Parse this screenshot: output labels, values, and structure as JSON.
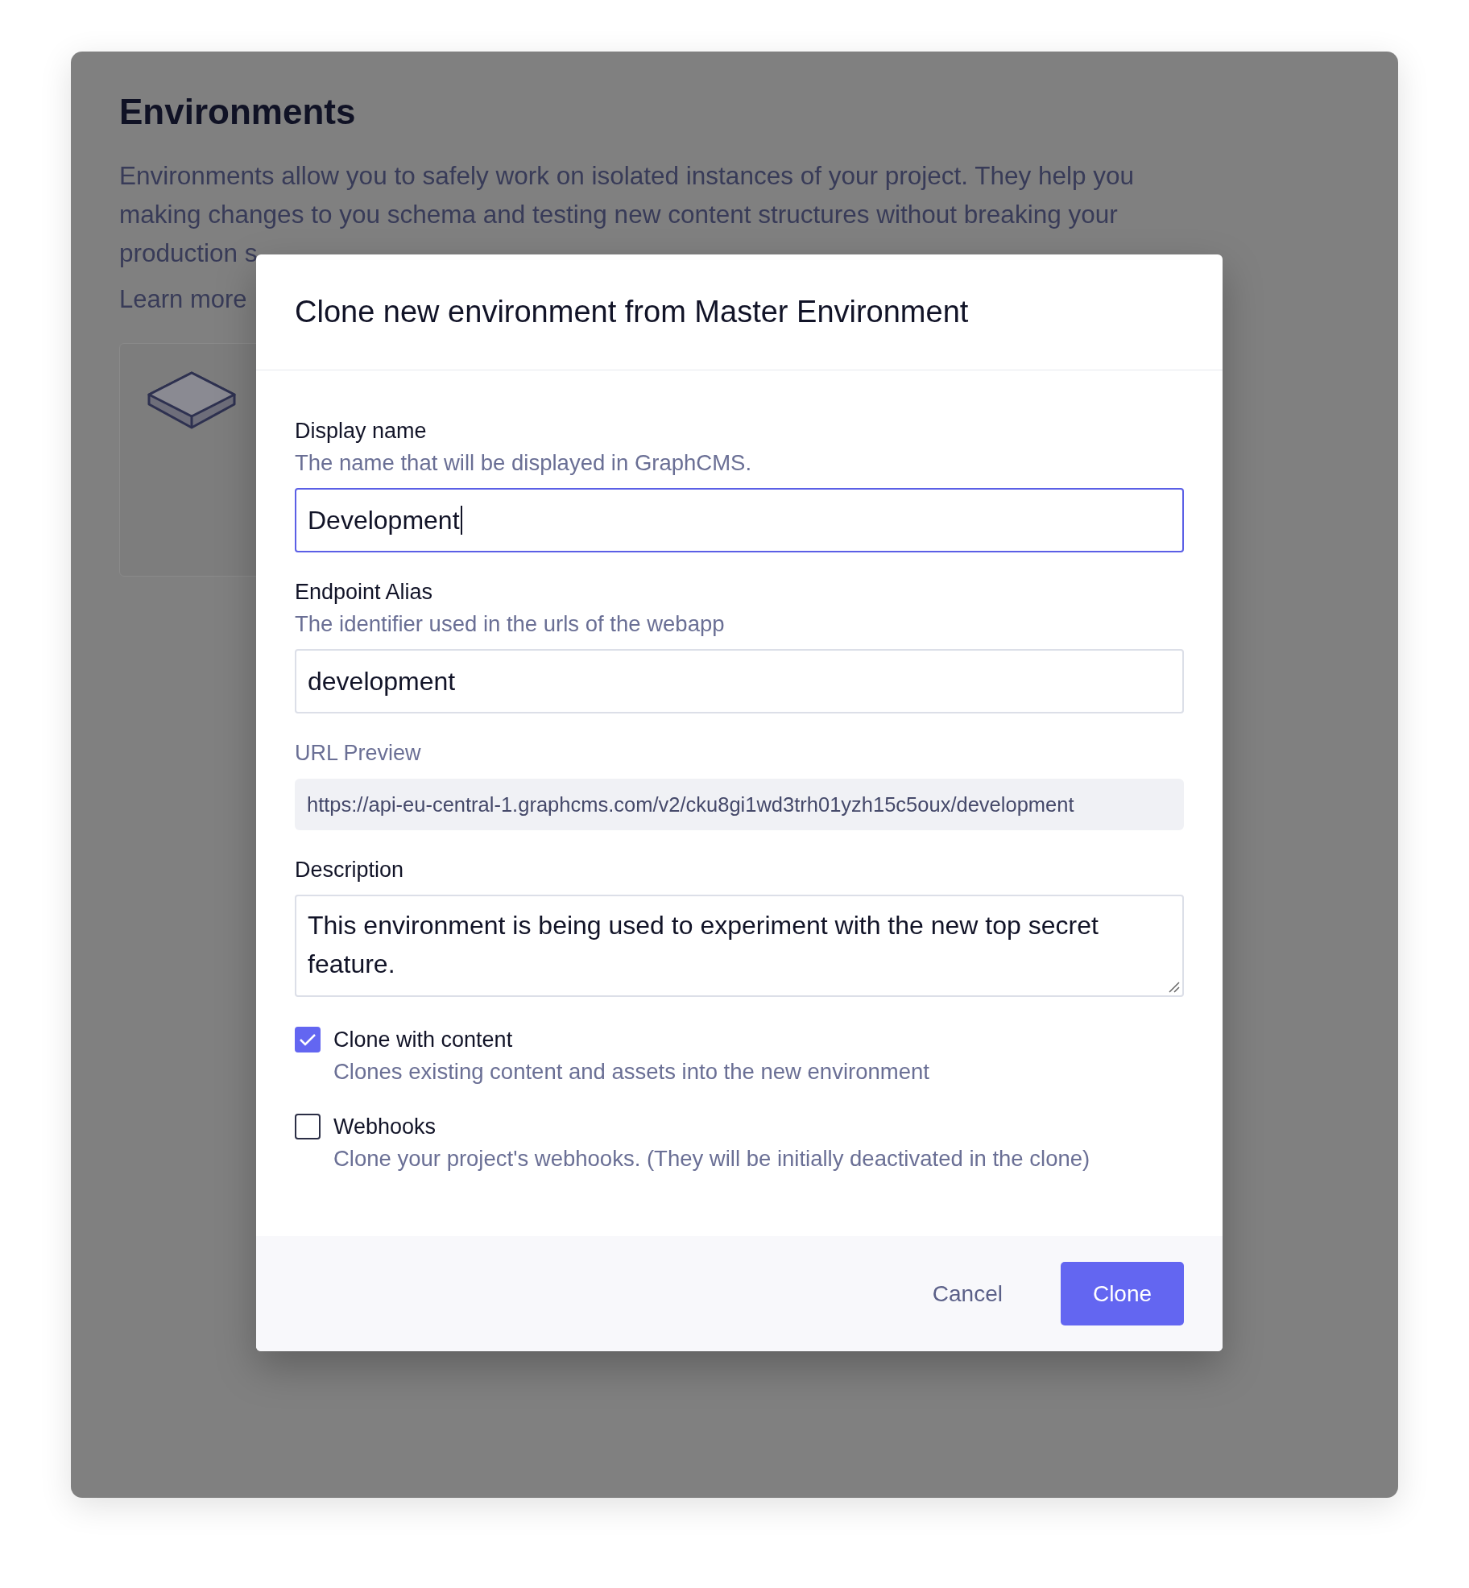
{
  "page": {
    "title": "Environments",
    "description_lines": [
      "Environments allow you to safely work on isolated instances of your project. They help you",
      "making changes to you schema and testing new content structures without breaking your",
      "production s"
    ],
    "link": "Learn more"
  },
  "dialog": {
    "title": "Clone new environment from Master Environment",
    "fields": [
      {
        "kind": "text",
        "label": "Display name",
        "hint": "The name that will be displayed in GraphCMS.",
        "value": "Development",
        "focused": true
      },
      {
        "kind": "text",
        "label": "Endpoint Alias",
        "hint": "The identifier used in the urls of the webapp",
        "value": "development",
        "focused": false
      },
      {
        "kind": "preview",
        "label": "URL Preview",
        "value": "https://api-eu-central-1.graphcms.com/v2/cku8gi1wd3trh01yzh15c5oux/development"
      },
      {
        "kind": "textarea",
        "label": "Description",
        "value": "This environment is being used to experiment with the new top secret feature."
      }
    ],
    "options": [
      {
        "label": "Clone with content",
        "hint": "Clones existing content and assets into the new environment",
        "checked": true
      },
      {
        "label": "Webhooks",
        "hint": "Clone your project's webhooks. (They will be initially deactivated in the clone)",
        "checked": false
      }
    ],
    "buttons": [
      {
        "kind": "secondary",
        "label": "Cancel"
      },
      {
        "kind": "primary",
        "label": "Clone"
      }
    ]
  }
}
